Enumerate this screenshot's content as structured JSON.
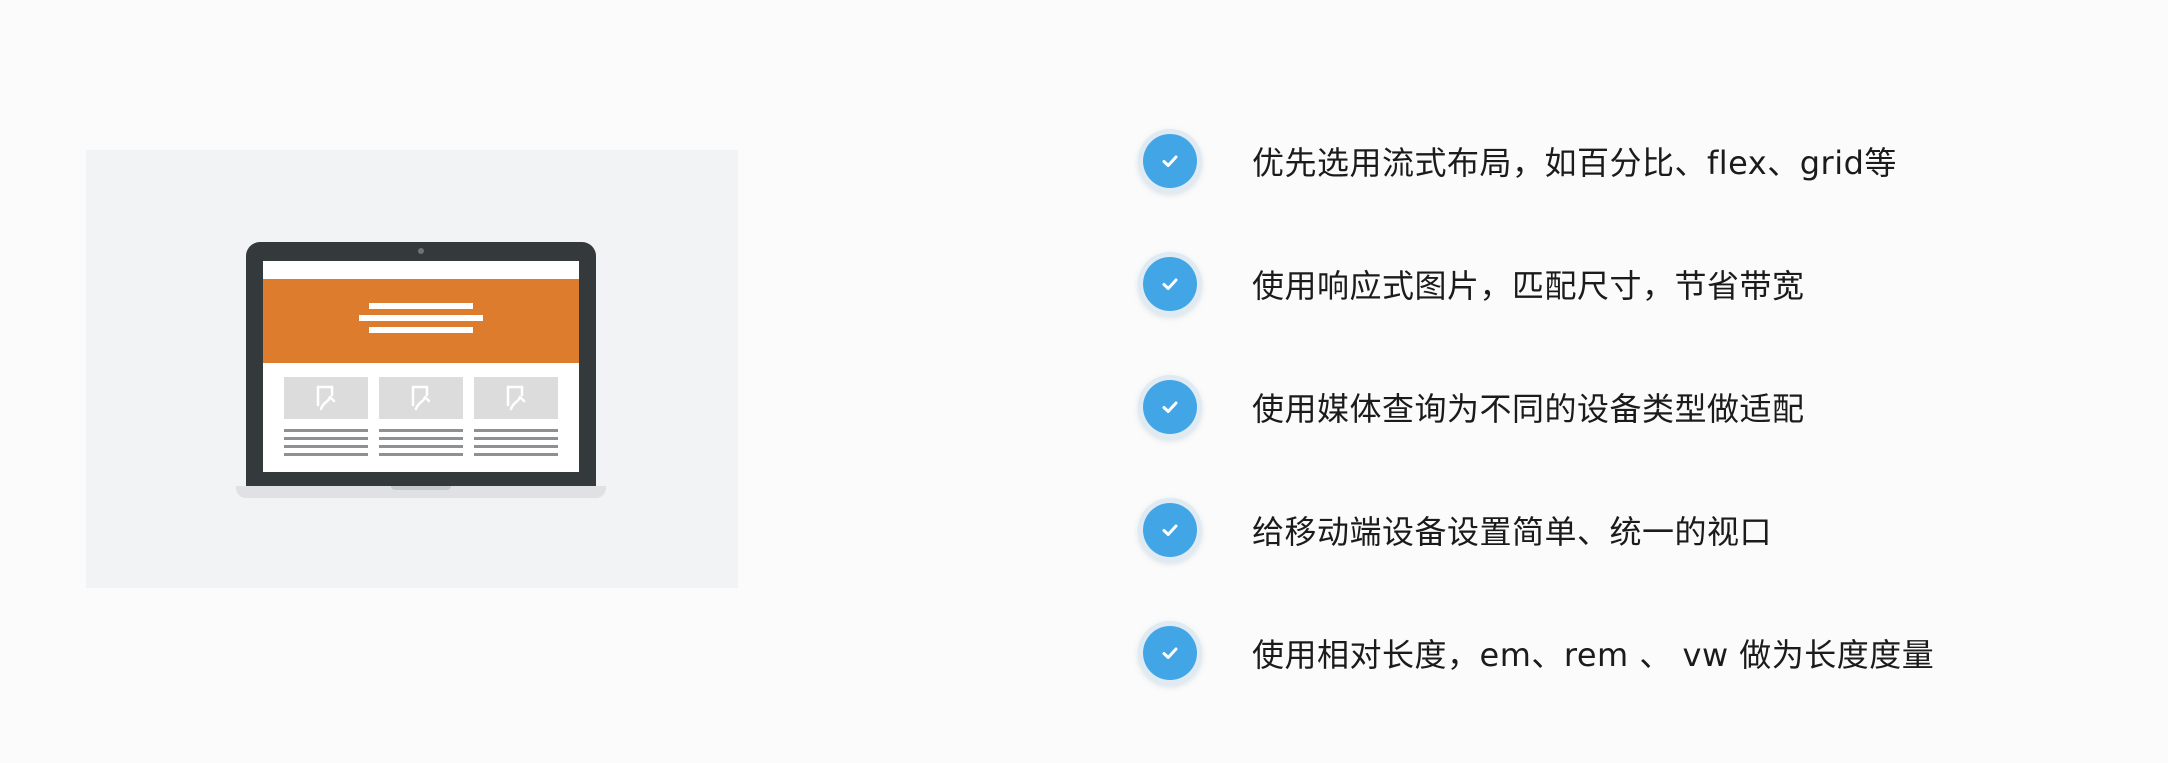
{
  "checklist": {
    "items": [
      {
        "text": "优先选用流式布局，如百分比、flex、grid等",
        "icon": "check-icon"
      },
      {
        "text": "使用响应式图片，匹配尺寸，节省带宽",
        "icon": "check-icon"
      },
      {
        "text": "使用媒体查询为不同的设备类型做适配",
        "icon": "check-icon"
      },
      {
        "text": "给移动端设备设置简单、统一的视口",
        "icon": "check-icon"
      },
      {
        "text": "使用相对长度，em、rem 、 vw 做为长度度量",
        "icon": "check-icon"
      }
    ]
  },
  "illustration": {
    "icon": "responsive-website-laptop-icon",
    "colors": {
      "header": "#de7c2e",
      "laptop": "#34393c",
      "check": "#42a6e6"
    }
  }
}
